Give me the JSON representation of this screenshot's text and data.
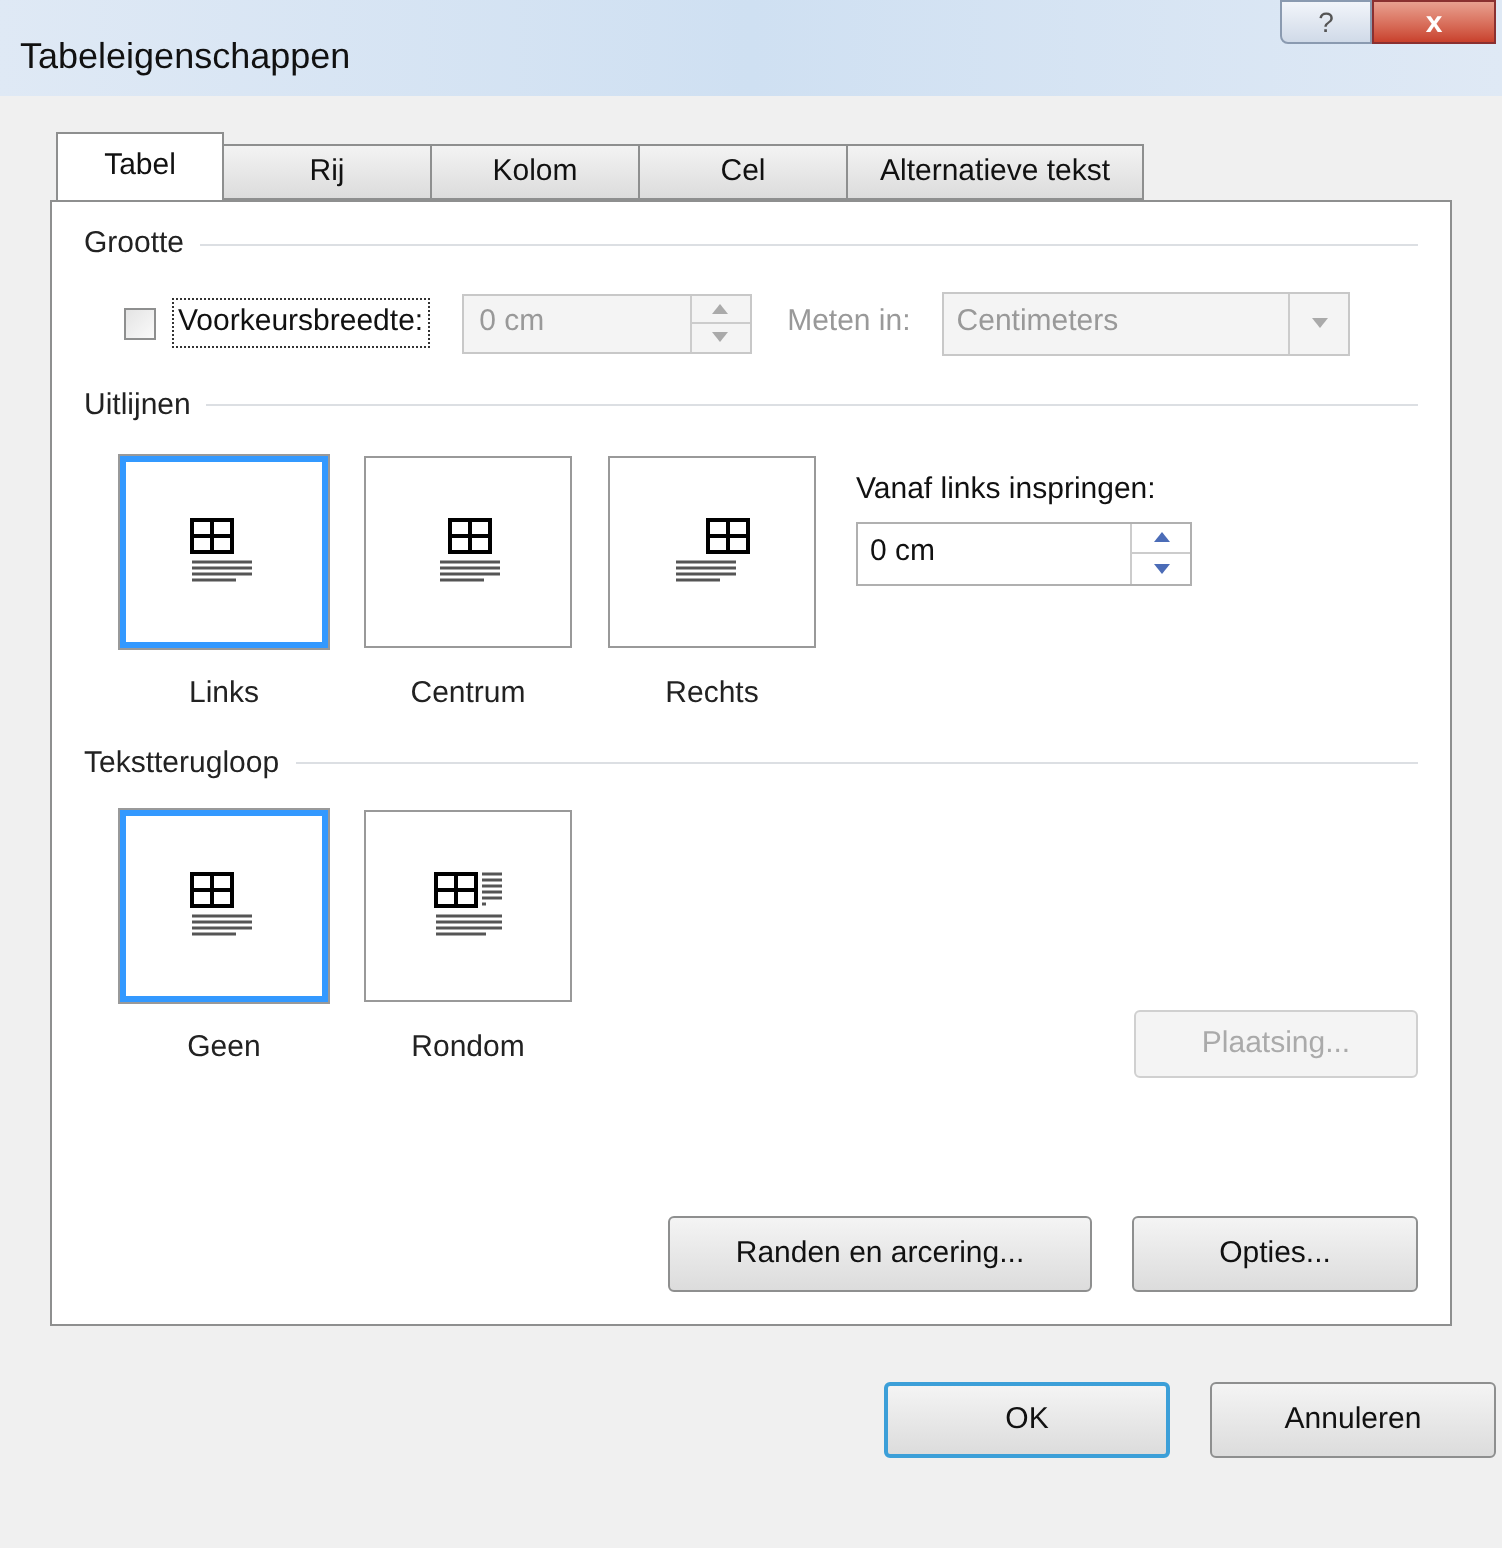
{
  "window": {
    "title": "Tabeleigenschappen",
    "help_button": "?",
    "close_button": "x"
  },
  "tabs": [
    {
      "label": "Tabel",
      "selected": true
    },
    {
      "label": "Rij",
      "selected": false
    },
    {
      "label": "Kolom",
      "selected": false
    },
    {
      "label": "Cel",
      "selected": false
    },
    {
      "label": "Alternatieve tekst",
      "selected": false
    }
  ],
  "size": {
    "heading": "Grootte",
    "preferred_width": {
      "label": "Voorkeursbreedte:",
      "checked": false,
      "value": "0 cm",
      "disabled": true
    },
    "measure_in": {
      "label": "Meten in:",
      "value": "Centimeters",
      "disabled": true
    }
  },
  "alignment": {
    "heading": "Uitlijnen",
    "options": [
      {
        "label": "Links",
        "kind": "left",
        "selected": true
      },
      {
        "label": "Centrum",
        "kind": "center",
        "selected": false
      },
      {
        "label": "Rechts",
        "kind": "right",
        "selected": false
      }
    ],
    "indent": {
      "label": "Vanaf links inspringen:",
      "value": "0 cm"
    }
  },
  "text_wrapping": {
    "heading": "Tekstterugloop",
    "options": [
      {
        "label": "Geen",
        "kind": "none",
        "selected": true
      },
      {
        "label": "Rondom",
        "kind": "around",
        "selected": false
      }
    ],
    "positioning_button": {
      "label": "Plaatsing...",
      "disabled": true
    }
  },
  "panel_buttons": [
    "Randen en arcering...",
    "Opties..."
  ],
  "footer_buttons": [
    {
      "label": "OK",
      "default": true
    },
    {
      "label": "Annuleren",
      "default": false
    }
  ]
}
